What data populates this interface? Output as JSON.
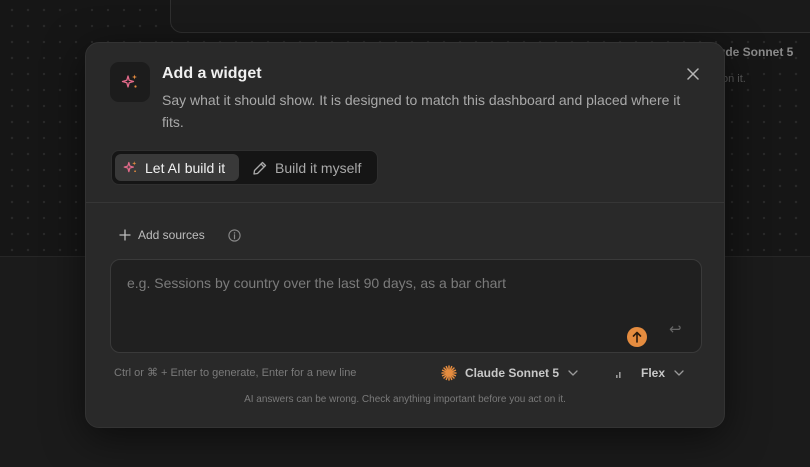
{
  "background": {
    "model_label": "ude Sonnet 5",
    "note": "on it."
  },
  "modal": {
    "icon": "sparkles-icon",
    "title": "Add a widget",
    "description": "Say what it should show. It is designed to match this dashboard and placed where it fits.",
    "close_icon": "close-icon"
  },
  "tabs": [
    {
      "label": "Let AI build it",
      "icon": "sparkles-icon",
      "active": true
    },
    {
      "label": "Build it myself",
      "icon": "pencil-icon",
      "active": false
    }
  ],
  "sources": {
    "add_label": "Add sources",
    "info_icon": "info-icon"
  },
  "prompt": {
    "placeholder": "e.g. Sessions by country over the last 90 days, as a bar chart",
    "value": ""
  },
  "footer": {
    "hint": "Ctrl or ⌘ + Enter to generate, Enter for a new line",
    "model": "Claude Sonnet 5",
    "mode": "Flex",
    "disclaimer": "AI answers can be wrong. Check anything important before you act on it."
  },
  "colors": {
    "accent": "#e58c3f",
    "ai_icon": "#e26a8a",
    "modal_bg": "#292929",
    "page_bg": "#161616"
  }
}
